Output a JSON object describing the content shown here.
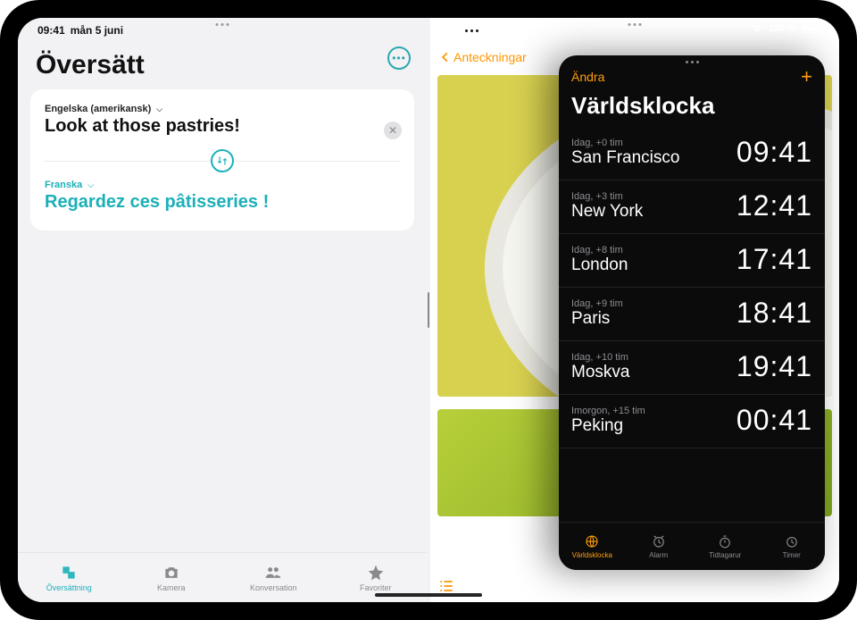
{
  "status": {
    "time": "09:41",
    "date": "mån 5 juni",
    "battery": "100 %"
  },
  "translate": {
    "title": "Översätt",
    "src_lang": "Engelska (amerikansk)",
    "src_text": "Look at those pastries!",
    "dst_lang": "Franska",
    "dst_text": "Regardez ces pâtisseries !",
    "tabs": {
      "translate": "Översättning",
      "camera": "Kamera",
      "conversation": "Konversation",
      "favorites": "Favoriter"
    }
  },
  "notes": {
    "back": "Anteckningar"
  },
  "clock": {
    "edit": "Ändra",
    "title": "Världsklocka",
    "rows": [
      {
        "offset": "Idag, +0 tim",
        "city": "San Francisco",
        "time": "09:41"
      },
      {
        "offset": "Idag, +3 tim",
        "city": "New York",
        "time": "12:41"
      },
      {
        "offset": "Idag, +8 tim",
        "city": "London",
        "time": "17:41"
      },
      {
        "offset": "Idag, +9 tim",
        "city": "Paris",
        "time": "18:41"
      },
      {
        "offset": "Idag, +10 tim",
        "city": "Moskva",
        "time": "19:41"
      },
      {
        "offset": "Imorgon, +15 tim",
        "city": "Peking",
        "time": "00:41"
      }
    ],
    "tabs": {
      "world": "Världsklocka",
      "alarm": "Alarm",
      "stopwatch": "Tidtagarur",
      "timer": "Timer"
    }
  }
}
